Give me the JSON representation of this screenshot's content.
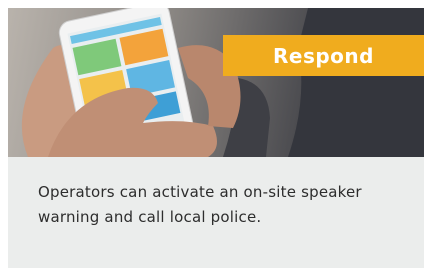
{
  "card": {
    "badge_label": "Respond",
    "description": "Operators can activate an on-site speaker warning and call local police."
  },
  "colors": {
    "badge": "#f0ac1e",
    "panel": "#ebedec",
    "text": "#2d2d2d"
  }
}
